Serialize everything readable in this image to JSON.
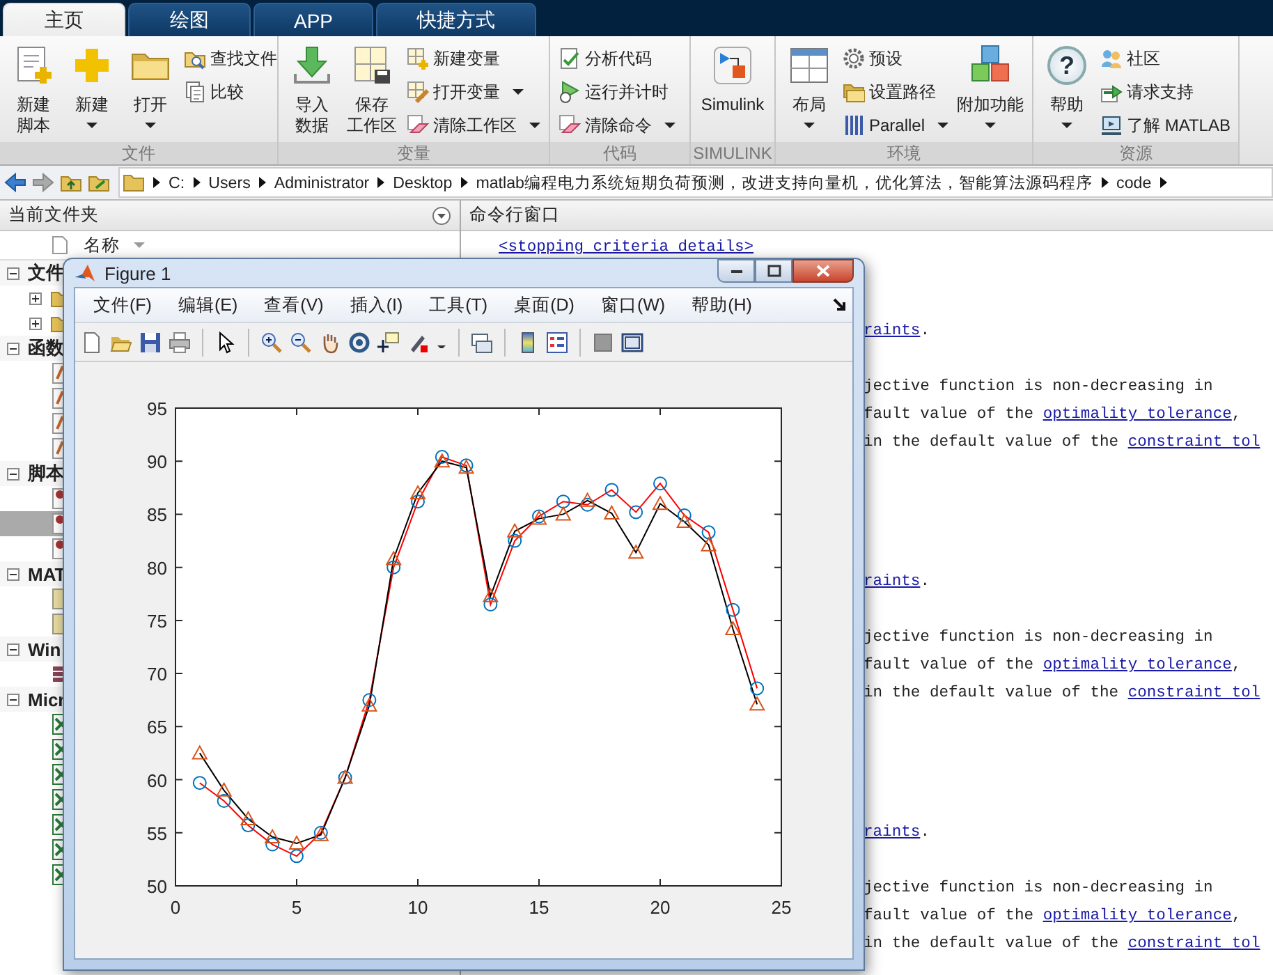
{
  "tabs": [
    {
      "label": "主页",
      "selected": true
    },
    {
      "label": "绘图",
      "selected": false
    },
    {
      "label": "APP",
      "selected": false
    },
    {
      "label": "快捷方式",
      "selected": false
    }
  ],
  "ribbon": [
    {
      "label": "文件",
      "items": [
        {
          "kind": "large",
          "lines": [
            "新建",
            "脚本"
          ],
          "dropdown": false
        },
        {
          "kind": "large",
          "lines": [
            "新建"
          ],
          "dropdown": true
        },
        {
          "kind": "large",
          "lines": [
            "打开"
          ],
          "dropdown": true
        },
        {
          "kind": "small",
          "lines": [
            "查找文件"
          ],
          "dropdown": false
        },
        {
          "kind": "small",
          "lines": [
            "比较"
          ],
          "dropdown": false
        }
      ]
    },
    {
      "label": "变量",
      "items": [
        {
          "kind": "large",
          "lines": [
            "导入",
            "数据"
          ],
          "dropdown": false
        },
        {
          "kind": "large",
          "lines": [
            "保存",
            "工作区"
          ],
          "dropdown": false
        },
        {
          "kind": "small",
          "lines": [
            "新建变量"
          ],
          "dropdown": false
        },
        {
          "kind": "small",
          "lines": [
            "打开变量"
          ],
          "dropdown": true
        },
        {
          "kind": "small",
          "lines": [
            "清除工作区"
          ],
          "dropdown": true
        }
      ]
    },
    {
      "label": "代码",
      "items": [
        {
          "kind": "small",
          "lines": [
            "分析代码"
          ],
          "dropdown": false
        },
        {
          "kind": "small",
          "lines": [
            "运行并计时"
          ],
          "dropdown": false
        },
        {
          "kind": "small",
          "lines": [
            "清除命令"
          ],
          "dropdown": true
        }
      ]
    },
    {
      "label": "SIMULINK",
      "items": [
        {
          "kind": "large",
          "lines": [
            "Simulink"
          ],
          "dropdown": false
        }
      ]
    },
    {
      "label": "环境",
      "items": [
        {
          "kind": "large",
          "lines": [
            "布局"
          ],
          "dropdown": true
        },
        {
          "kind": "small",
          "lines": [
            "预设"
          ],
          "dropdown": false
        },
        {
          "kind": "small",
          "lines": [
            "设置路径"
          ],
          "dropdown": false
        },
        {
          "kind": "small",
          "lines": [
            "Parallel"
          ],
          "dropdown": true
        },
        {
          "kind": "large",
          "lines": [
            "附加功能"
          ],
          "dropdown": true
        }
      ]
    },
    {
      "label": "资源",
      "items": [
        {
          "kind": "large",
          "lines": [
            "帮助"
          ],
          "dropdown": true,
          "glyph": "?"
        },
        {
          "kind": "small",
          "lines": [
            "社区"
          ],
          "dropdown": false
        },
        {
          "kind": "small",
          "lines": [
            "请求支持"
          ],
          "dropdown": false
        },
        {
          "kind": "small",
          "lines": [
            "了解 MATLAB"
          ],
          "dropdown": false
        }
      ]
    }
  ],
  "address": {
    "segments": [
      "C:",
      "Users",
      "Administrator",
      "Desktop",
      "matlab编程电力系统短期负荷预测，改进支持向量机，优化算法，智能算法源码程序",
      "code"
    ]
  },
  "left_panel": {
    "title": "当前文件夹",
    "column": "名称",
    "sections": [
      {
        "label": "文件",
        "expanded": true,
        "children": [
          {
            "kind": "folder",
            "expanded": false,
            "selected": false
          },
          {
            "kind": "folder",
            "expanded": false,
            "selected": false
          }
        ]
      },
      {
        "label": "函数",
        "expanded": true,
        "children": [
          {
            "kind": "function",
            "selected": false
          },
          {
            "kind": "function",
            "selected": false
          },
          {
            "kind": "function",
            "selected": false
          },
          {
            "kind": "function",
            "selected": false
          }
        ]
      },
      {
        "label": "脚本",
        "expanded": true,
        "children": [
          {
            "kind": "script",
            "selected": false
          },
          {
            "kind": "script",
            "selected": true
          },
          {
            "kind": "script",
            "selected": false
          }
        ]
      },
      {
        "label": "MAT",
        "expanded": true,
        "children": [
          {
            "kind": "mat",
            "selected": false
          },
          {
            "kind": "mat",
            "selected": false
          }
        ]
      },
      {
        "label": "Win",
        "expanded": true,
        "children": [
          {
            "kind": "app",
            "selected": false
          }
        ]
      },
      {
        "label": "Micr",
        "expanded": true,
        "children": [
          {
            "kind": "excel",
            "selected": false
          },
          {
            "kind": "excel",
            "selected": false
          },
          {
            "kind": "excel",
            "selected": false
          },
          {
            "kind": "excel",
            "selected": false
          },
          {
            "kind": "excel",
            "selected": false
          },
          {
            "kind": "excel",
            "selected": false
          },
          {
            "kind": "excel",
            "selected": false
          }
        ]
      }
    ]
  },
  "command_window": {
    "title": "命令行窗口",
    "lines": [
      {
        "kind": "full",
        "parts": [
          {
            "text": "<stopping criteria details>",
            "link": true
          }
        ]
      },
      {
        "kind": "blank"
      },
      {
        "kind": "blank"
      },
      {
        "kind": "clipped",
        "parts": [
          {
            "text": "raints",
            "link": true
          },
          {
            "text": ".",
            "link": false
          }
        ]
      },
      {
        "kind": "blank"
      },
      {
        "kind": "clipped",
        "parts": [
          {
            "text": "jective function is non-decreasing in",
            "link": false
          }
        ]
      },
      {
        "kind": "clipped",
        "parts": [
          {
            "text": "fault value of the ",
            "link": false
          },
          {
            "text": "optimality tolerance",
            "link": true
          },
          {
            "text": ",",
            "link": false
          }
        ]
      },
      {
        "kind": "clipped",
        "parts": [
          {
            "text": "in the default value of the ",
            "link": false
          },
          {
            "text": "constraint tol",
            "link": true
          }
        ]
      },
      {
        "kind": "blank"
      },
      {
        "kind": "blank"
      },
      {
        "kind": "blank"
      },
      {
        "kind": "blank"
      },
      {
        "kind": "clipped",
        "parts": [
          {
            "text": "raints",
            "link": true
          },
          {
            "text": ".",
            "link": false
          }
        ]
      },
      {
        "kind": "blank"
      },
      {
        "kind": "clipped",
        "parts": [
          {
            "text": "jective function is non-decreasing in",
            "link": false
          }
        ]
      },
      {
        "kind": "clipped",
        "parts": [
          {
            "text": "fault value of the ",
            "link": false
          },
          {
            "text": "optimality tolerance",
            "link": true
          },
          {
            "text": ",",
            "link": false
          }
        ]
      },
      {
        "kind": "clipped",
        "parts": [
          {
            "text": "in the default value of the ",
            "link": false
          },
          {
            "text": "constraint tol",
            "link": true
          }
        ]
      },
      {
        "kind": "blank"
      },
      {
        "kind": "blank"
      },
      {
        "kind": "blank"
      },
      {
        "kind": "blank"
      },
      {
        "kind": "clipped",
        "parts": [
          {
            "text": "raints",
            "link": true
          },
          {
            "text": ".",
            "link": false
          }
        ]
      },
      {
        "kind": "blank"
      },
      {
        "kind": "clipped",
        "parts": [
          {
            "text": "jective function is non-decreasing in",
            "link": false
          }
        ]
      },
      {
        "kind": "clipped",
        "parts": [
          {
            "text": "fault value of the ",
            "link": false
          },
          {
            "text": "optimality tolerance",
            "link": true
          },
          {
            "text": ",",
            "link": false
          }
        ]
      },
      {
        "kind": "clipped",
        "parts": [
          {
            "text": "in the default value of the ",
            "link": false
          },
          {
            "text": "constraint tol",
            "link": true
          }
        ]
      }
    ]
  },
  "figure": {
    "title": "Figure 1",
    "menu": [
      "文件(F)",
      "编辑(E)",
      "查看(V)",
      "插入(I)",
      "工具(T)",
      "桌面(D)",
      "窗口(W)",
      "帮助(H)"
    ],
    "chart_data": {
      "type": "line",
      "xlim": [
        0,
        25
      ],
      "ylim": [
        50,
        95
      ],
      "xticks": [
        0,
        5,
        10,
        15,
        20,
        25
      ],
      "yticks": [
        50,
        55,
        60,
        65,
        70,
        75,
        80,
        85,
        90,
        95
      ],
      "x": [
        1,
        2,
        3,
        4,
        5,
        6,
        7,
        8,
        9,
        10,
        11,
        12,
        13,
        14,
        15,
        16,
        17,
        18,
        19,
        20,
        21,
        22,
        23,
        24
      ],
      "series": [
        {
          "color": "#ff0000",
          "marker": "circle",
          "values": [
            59.7,
            58.0,
            55.7,
            53.9,
            52.8,
            55.0,
            60.2,
            67.5,
            80.0,
            86.2,
            90.4,
            89.6,
            76.5,
            82.5,
            84.8,
            86.2,
            85.9,
            87.3,
            85.2,
            87.9,
            84.9,
            83.3,
            76.0,
            68.6
          ]
        },
        {
          "color": "#000000",
          "marker": "triangle",
          "values": [
            62.5,
            59.0,
            56.3,
            54.6,
            54.0,
            54.8,
            60.2,
            67.0,
            80.8,
            87.0,
            90.0,
            89.4,
            77.3,
            83.4,
            84.6,
            85.0,
            86.3,
            85.1,
            81.4,
            86.0,
            84.3,
            82.1,
            74.2,
            67.1
          ]
        }
      ]
    }
  }
}
